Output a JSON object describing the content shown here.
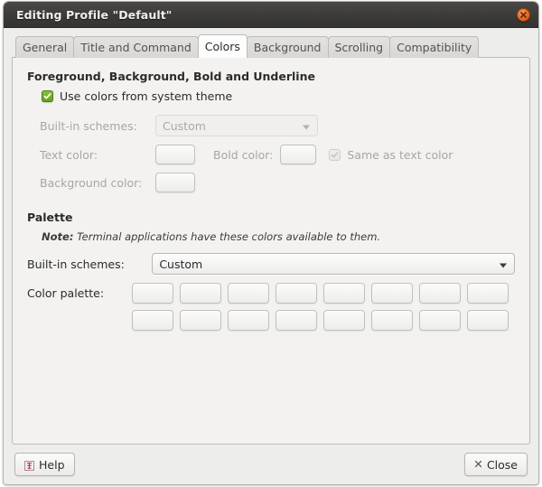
{
  "window": {
    "title": "Editing Profile \"Default\"",
    "close_icon": "close-circle-icon"
  },
  "tabs": [
    {
      "label": "General",
      "active": false
    },
    {
      "label": "Title and Command",
      "active": false
    },
    {
      "label": "Colors",
      "active": true
    },
    {
      "label": "Background",
      "active": false
    },
    {
      "label": "Scrolling",
      "active": false
    },
    {
      "label": "Compatibility",
      "active": false
    }
  ],
  "foreground_section": {
    "title": "Foreground, Background, Bold and Underline",
    "use_system_theme": {
      "label": "Use colors from system theme",
      "checked": true,
      "icon": "checkmark-icon"
    },
    "builtin_schemes": {
      "label": "Built-in schemes:",
      "value": "Custom",
      "disabled": true,
      "icon": "chevron-down-icon"
    },
    "text_color": {
      "label": "Text color:",
      "value": "#ebeae8",
      "disabled": true
    },
    "bold_color": {
      "label": "Bold color:",
      "value": "#ebeae8",
      "disabled": true
    },
    "same_as_text": {
      "label": "Same as text color",
      "checked": true,
      "disabled": true,
      "icon": "checkmark-icon"
    },
    "background_color": {
      "label": "Background color:",
      "value": "#fbfbd7",
      "disabled": true
    }
  },
  "palette_section": {
    "title": "Palette",
    "note_prefix": "Note:",
    "note_text": "Terminal applications have these colors available to them.",
    "builtin_schemes": {
      "label": "Built-in schemes:",
      "value": "Custom",
      "icon": "chevron-down-icon"
    },
    "color_palette": {
      "label": "Color palette:",
      "rows": [
        [
          "#2e2e2e",
          "#cc0000",
          "#4e9a06",
          "#c4a000",
          "#3465a4",
          "#75507b",
          "#06989a",
          "#d8d8d6"
        ],
        [
          "#4f4f4f",
          "#ef2929",
          "#8ae234",
          "#fce94f",
          "#729fcf",
          "#ad7fa8",
          "#34e2e2",
          "#eeeeec"
        ]
      ]
    }
  },
  "actions": {
    "help": {
      "label": "Help",
      "icon": "help-icon"
    },
    "close": {
      "label": "Close",
      "icon": "close-x-icon"
    }
  }
}
